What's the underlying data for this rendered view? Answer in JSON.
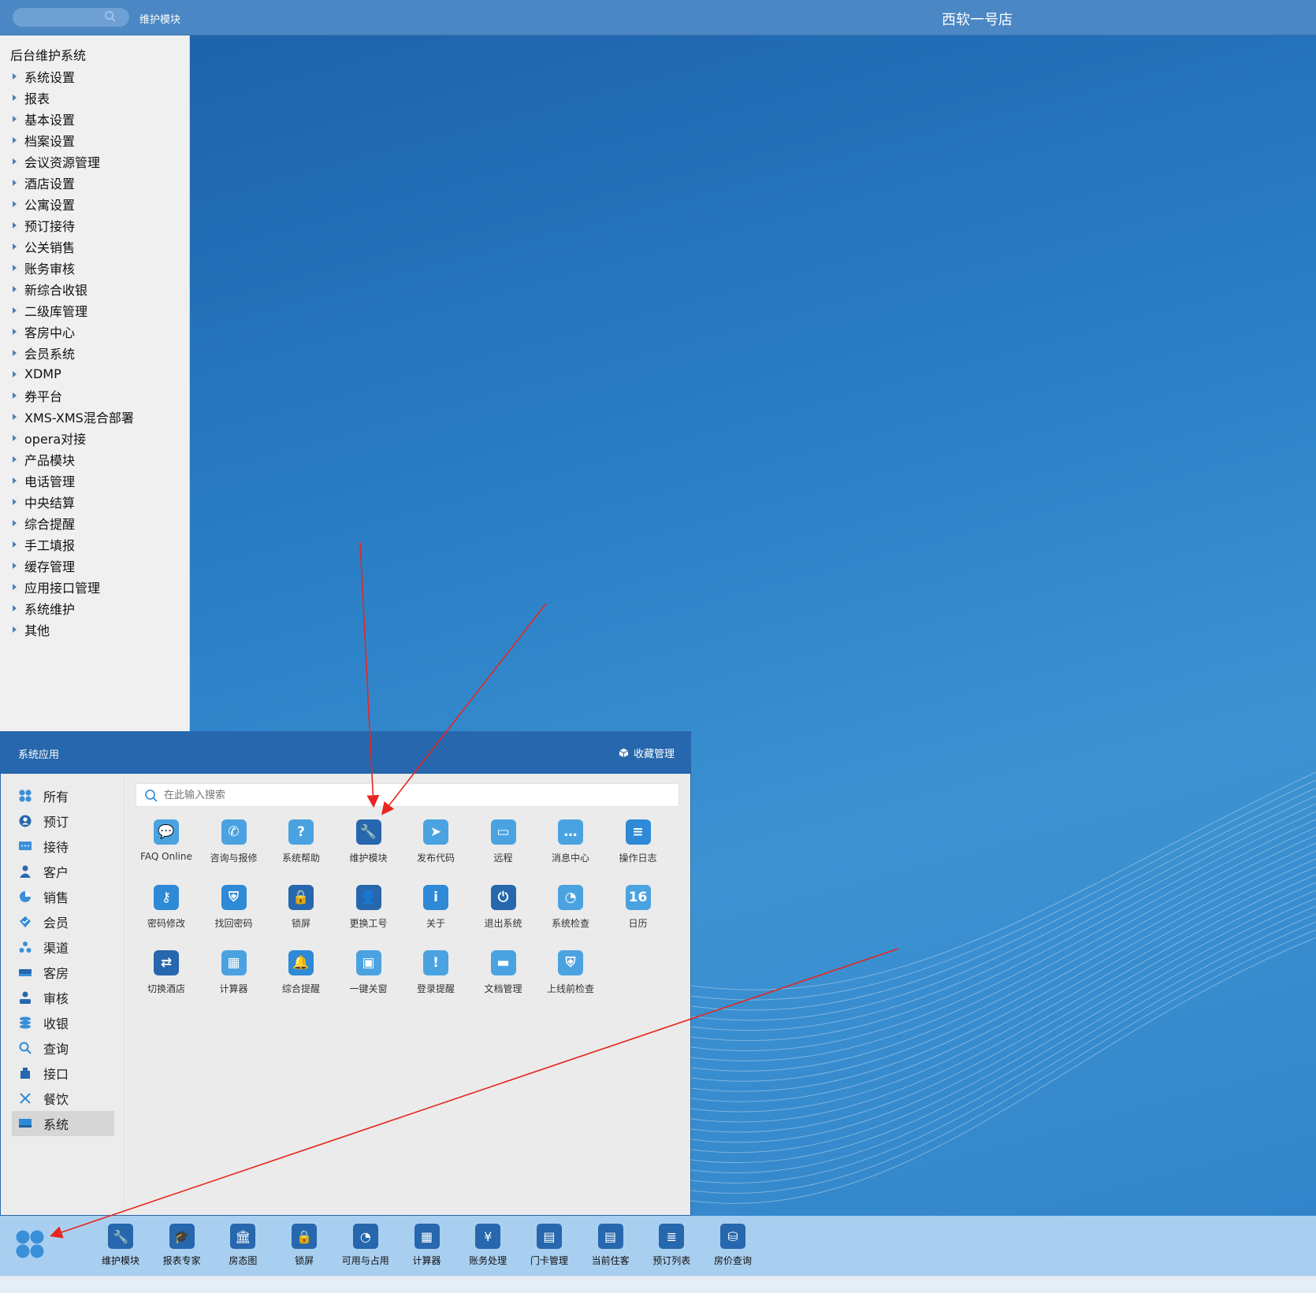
{
  "topbar": {
    "module_title": "维护模块",
    "hotel_name": "西软一号店"
  },
  "tree": {
    "root": "后台维护系统",
    "items": [
      "系统设置",
      "报表",
      "基本设置",
      "档案设置",
      "会议资源管理",
      "酒店设置",
      "公寓设置",
      "预订接待",
      "公关销售",
      "账务审核",
      "新综合收银",
      "二级库管理",
      "客房中心",
      "会员系统",
      "XDMP",
      "券平台",
      "XMS-XMS混合部署",
      "opera对接",
      "产品模块",
      "电话管理",
      "中央结算",
      "综合提醒",
      "手工填报",
      "缓存管理",
      "应用接口管理",
      "系统维护",
      "其他"
    ]
  },
  "panel": {
    "title": "系统应用",
    "favorites_label": "收藏管理",
    "search_placeholder": "在此输入搜索",
    "categories": [
      {
        "label": "所有",
        "icon": "grid-icon"
      },
      {
        "label": "预订",
        "icon": "user-circle-icon"
      },
      {
        "label": "接待",
        "icon": "chat-card-icon"
      },
      {
        "label": "客户",
        "icon": "person-icon"
      },
      {
        "label": "销售",
        "icon": "pie-icon"
      },
      {
        "label": "会员",
        "icon": "diamond-icon"
      },
      {
        "label": "渠道",
        "icon": "cluster-icon"
      },
      {
        "label": "客房",
        "icon": "bed-icon"
      },
      {
        "label": "审核",
        "icon": "reviewer-icon"
      },
      {
        "label": "收银",
        "icon": "coins-icon"
      },
      {
        "label": "查询",
        "icon": "search-icon"
      },
      {
        "label": "接口",
        "icon": "usb-icon"
      },
      {
        "label": "餐饮",
        "icon": "cutlery-icon"
      },
      {
        "label": "系统",
        "icon": "monitor-icon"
      }
    ],
    "active_category": "系统",
    "apps": [
      {
        "label": "FAQ Online",
        "icon": "chat-bubbles-icon",
        "glyph": "💬",
        "color": "#4aa3e0"
      },
      {
        "label": "咨询与报修",
        "icon": "phone-icon",
        "glyph": "✆",
        "color": "#4aa3e0"
      },
      {
        "label": "系统帮助",
        "icon": "question-icon",
        "glyph": "?",
        "color": "#4aa3e0"
      },
      {
        "label": "维护模块",
        "icon": "wrench-icon",
        "glyph": "🔧",
        "color": "#2667ad"
      },
      {
        "label": "发布代码",
        "icon": "paper-plane-icon",
        "glyph": "➤",
        "color": "#4aa3e0"
      },
      {
        "label": "远程",
        "icon": "laptop-icon",
        "glyph": "▭",
        "color": "#4aa3e0"
      },
      {
        "label": "消息中心",
        "icon": "message-icon",
        "glyph": "…",
        "color": "#4aa3e0"
      },
      {
        "label": "操作日志",
        "icon": "log-icon",
        "glyph": "≡",
        "color": "#2e8ad6"
      },
      {
        "label": "密码修改",
        "icon": "key-icon",
        "glyph": "⚷",
        "color": "#2e8ad6"
      },
      {
        "label": "找回密码",
        "icon": "shield-user-icon",
        "glyph": "⛨",
        "color": "#2e8ad6"
      },
      {
        "label": "锁屏",
        "icon": "lock-icon",
        "glyph": "🔒",
        "color": "#2667ad"
      },
      {
        "label": "更换工号",
        "icon": "id-user-icon",
        "glyph": "👤",
        "color": "#2667ad"
      },
      {
        "label": "关于",
        "icon": "info-icon",
        "glyph": "i",
        "color": "#2e8ad6"
      },
      {
        "label": "退出系统",
        "icon": "power-icon",
        "glyph": "⏻",
        "color": "#2667ad"
      },
      {
        "label": "系统检查",
        "icon": "gauge-icon",
        "glyph": "◔",
        "color": "#4aa3e0"
      },
      {
        "label": "日历",
        "icon": "calendar-icon",
        "glyph": "16",
        "color": "#4aa3e0"
      },
      {
        "label": "切换酒店",
        "icon": "swap-icon",
        "glyph": "⇄",
        "color": "#2667ad"
      },
      {
        "label": "计算器",
        "icon": "calculator-icon",
        "glyph": "▦",
        "color": "#4aa3e0"
      },
      {
        "label": "综合提醒",
        "icon": "bell-icon",
        "glyph": "🔔",
        "color": "#2e8ad6"
      },
      {
        "label": "一键关窗",
        "icon": "close-window-icon",
        "glyph": "▣",
        "color": "#4aa3e0"
      },
      {
        "label": "登录提醒",
        "icon": "alert-icon",
        "glyph": "!",
        "color": "#4aa3e0"
      },
      {
        "label": "文档管理",
        "icon": "folder-icon",
        "glyph": "▬",
        "color": "#4aa3e0"
      },
      {
        "label": "上线前检查",
        "icon": "shield-search-icon",
        "glyph": "⛨",
        "color": "#4aa3e0"
      }
    ]
  },
  "dock": {
    "start_icon": "clover-start-icon",
    "items": [
      {
        "label": "维护模块",
        "icon": "wrench-icon",
        "glyph": "🔧"
      },
      {
        "label": "报表专家",
        "icon": "graduation-cap-icon",
        "glyph": "🎓"
      },
      {
        "label": "房态图",
        "icon": "bank-icon",
        "glyph": "🏛"
      },
      {
        "label": "锁屏",
        "icon": "lock-icon",
        "glyph": "🔒"
      },
      {
        "label": "可用与占用",
        "icon": "pie-chart-icon",
        "glyph": "◔"
      },
      {
        "label": "计算器",
        "icon": "calculator-icon",
        "glyph": "▦"
      },
      {
        "label": "账务处理",
        "icon": "finance-user-icon",
        "glyph": "¥"
      },
      {
        "label": "门卡管理",
        "icon": "card-icon",
        "glyph": "▤"
      },
      {
        "label": "当前住客",
        "icon": "guest-card-icon",
        "glyph": "▤"
      },
      {
        "label": "预订列表",
        "icon": "booking-list-icon",
        "glyph": "≣"
      },
      {
        "label": "房价查询",
        "icon": "price-query-icon",
        "glyph": "⛁"
      }
    ]
  },
  "colors": {
    "brand": "#2667ad",
    "annotation": "#e8261f"
  }
}
